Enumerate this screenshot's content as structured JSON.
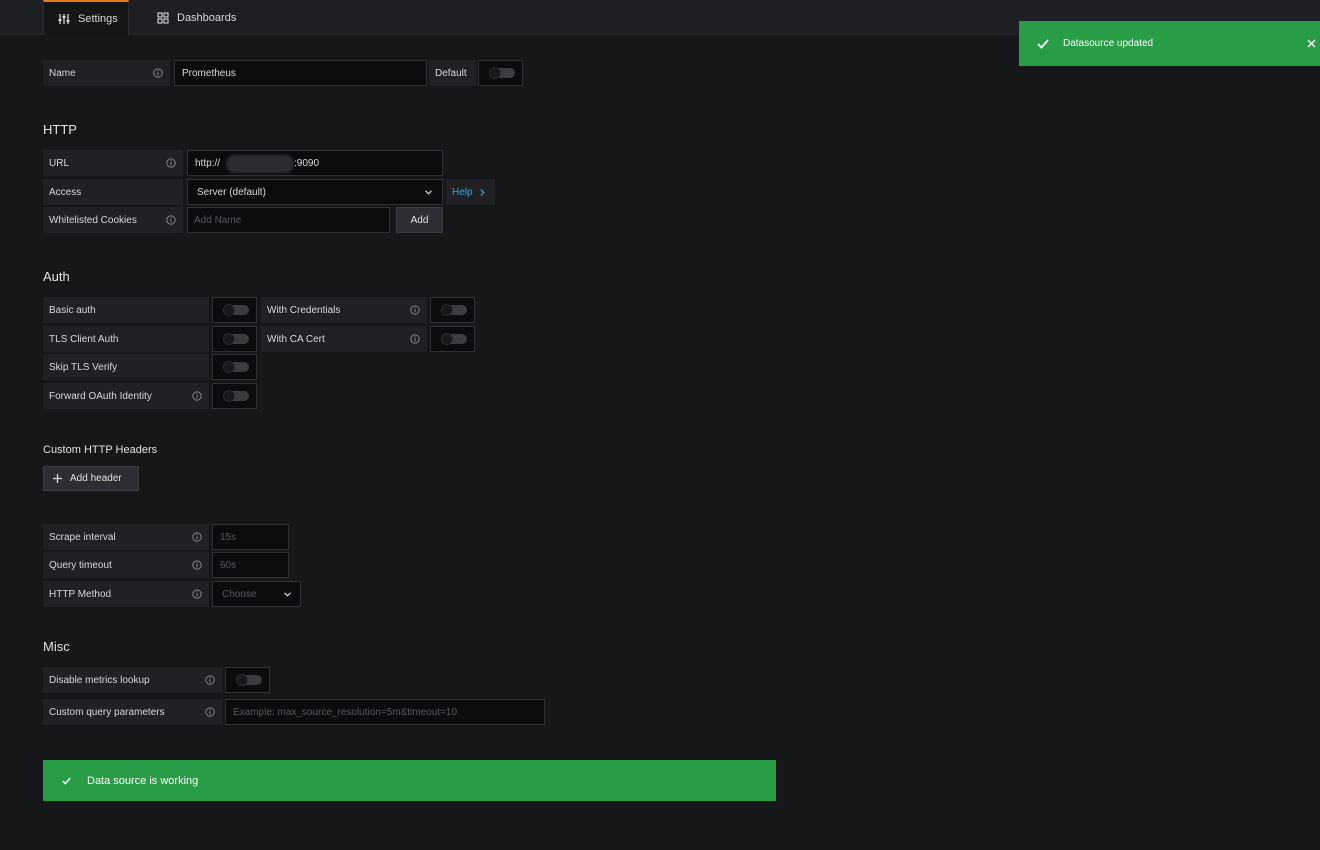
{
  "tabs": [
    {
      "label": "Settings",
      "icon": "sliders-icon",
      "active": true
    },
    {
      "label": "Dashboards",
      "icon": "grid-icon",
      "active": false
    }
  ],
  "toast": {
    "message": "Datasource updated",
    "color": "#299c46"
  },
  "name_row": {
    "label": "Name",
    "value": "Prometheus",
    "default_label": "Default"
  },
  "http": {
    "heading": "HTTP",
    "url_label": "URL",
    "url_value": "http://",
    "url_suffix": ":9090",
    "access_label": "Access",
    "access_value": "Server (default)",
    "help_label": "Help",
    "cookies_label": "Whitelisted Cookies",
    "cookies_placeholder": "Add Name",
    "add_label": "Add"
  },
  "auth": {
    "heading": "Auth",
    "basic_auth": "Basic auth",
    "with_credentials": "With Credentials",
    "tls_client_auth": "TLS Client Auth",
    "with_ca_cert": "With CA Cert",
    "skip_tls": "Skip TLS Verify",
    "forward_oauth": "Forward OAuth Identity"
  },
  "headers": {
    "heading": "Custom HTTP Headers",
    "add_header_label": "Add header"
  },
  "prom": {
    "scrape_label": "Scrape interval",
    "scrape_placeholder": "15s",
    "timeout_label": "Query timeout",
    "timeout_placeholder": "60s",
    "method_label": "HTTP Method",
    "method_placeholder": "Choose"
  },
  "misc": {
    "heading": "Misc",
    "disable_metrics_label": "Disable metrics lookup",
    "custom_query_label": "Custom query parameters",
    "custom_query_placeholder": "Example: max_source_resolution=5m&timeout=10"
  },
  "banner": {
    "message": "Data source is working",
    "color": "#299c46"
  }
}
